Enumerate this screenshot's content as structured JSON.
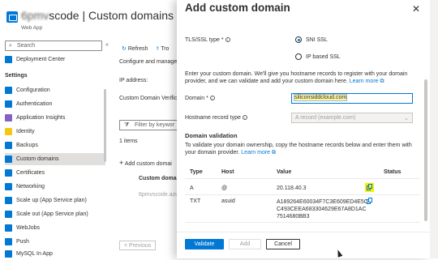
{
  "header": {
    "title_blur": "6pmv",
    "title_rest": "scode | Custom domains",
    "subtitle": "Web App"
  },
  "sidebar": {
    "search_placeholder": "Search",
    "collapse_glyph": "«",
    "top_item": "Deployment Center",
    "heading": "Settings",
    "items": [
      {
        "label": "Configuration",
        "color": "#0078d4"
      },
      {
        "label": "Authentication",
        "color": "#0078d4"
      },
      {
        "label": "Application Insights",
        "color": "#8661c5"
      },
      {
        "label": "Identity",
        "color": "#f2c811"
      },
      {
        "label": "Backups",
        "color": "#0078d4"
      },
      {
        "label": "Custom domains",
        "color": "#0078d4",
        "active": true
      },
      {
        "label": "Certificates",
        "color": "#0078d4"
      },
      {
        "label": "Networking",
        "color": "#0078d4"
      },
      {
        "label": "Scale up (App Service plan)",
        "color": "#0078d4"
      },
      {
        "label": "Scale out (App Service plan)",
        "color": "#0078d4"
      },
      {
        "label": "WebJobs",
        "color": "#0078d4"
      },
      {
        "label": "Push",
        "color": "#0078d4"
      },
      {
        "label": "MySQL In App",
        "color": "#0078d4"
      }
    ]
  },
  "main": {
    "refresh": "Refresh",
    "troubleshoot": "Tro",
    "configure_text": "Configure and manage",
    "ip_label": "IP address:",
    "verification_label": "Custom Domain Verific",
    "filter_placeholder": "Filter by keywor",
    "items_count": "1 items",
    "add_custom_domain": "Add custom domai",
    "col_custom_domain": "Custom domai",
    "row_domain": "6pmvscode.azu",
    "previous": "< Previous"
  },
  "panel": {
    "title": "Add custom domain",
    "close": "✕",
    "tls_label": "TLS/SSL type *",
    "sni": "SNI SSL",
    "ip_based": "IP based SSL",
    "intro": "Enter your custom domain. We'll give you hostname records to register with your domain provider, and we can validate and add your custom domain here.",
    "learn_more": "Learn more",
    "domain_label": "Domain *",
    "domain_value": "siliconsiddcloud.com",
    "hostname_label": "Hostname record type",
    "hostname_placeholder": "A record (example.com)",
    "validation_heading": "Domain validation",
    "validation_text": "To validate your domain ownership, copy the hostname records below and enter them with your domain provider.",
    "columns": [
      "Type",
      "Host",
      "Value",
      "Status"
    ],
    "records": [
      {
        "type": "A",
        "host": "@",
        "value": "20.118.40.3"
      },
      {
        "type": "TXT",
        "host": "asuid",
        "value_lines": [
          "A189264E60034F7C3E609ED4E5C",
          "C493CEEA683304629E67A8D1AC",
          "7514680BB3"
        ]
      }
    ],
    "validate": "Validate",
    "add": "Add",
    "cancel": "Cancel"
  }
}
